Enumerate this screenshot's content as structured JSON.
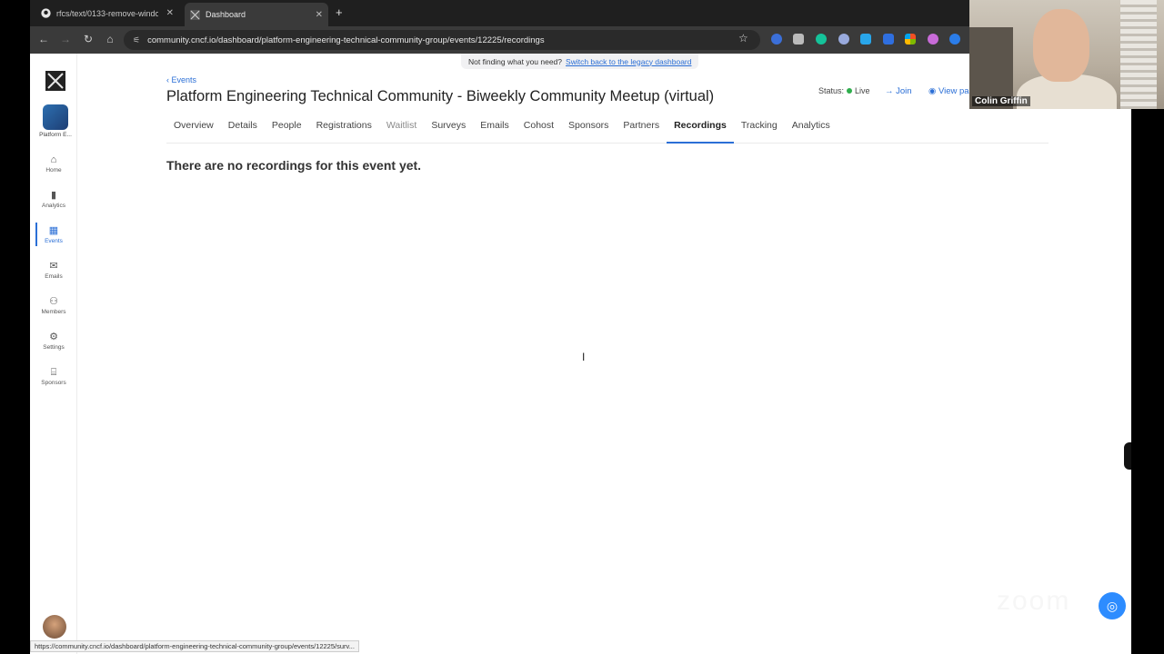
{
  "browser": {
    "tabs": [
      {
        "label": "rfcs/text/0133-remove-window",
        "icon": "github-icon"
      },
      {
        "label": "Dashboard",
        "icon": "dashboard-favicon"
      }
    ],
    "url": "community.cncf.io/dashboard/platform-engineering-technical-community-group/events/12225/recordings",
    "status_url": "https://community.cncf.io/dashboard/platform-engineering-technical-community-group/events/12225/surv..."
  },
  "banner": {
    "text": "Not finding what you need?",
    "link": "Switch back to the legacy dashboard"
  },
  "sidebar": {
    "group_label": "Platform E...",
    "items": [
      {
        "label": "Home",
        "icon": "home-icon",
        "glyph": "⌂"
      },
      {
        "label": "Analytics",
        "icon": "analytics-icon",
        "glyph": "▮"
      },
      {
        "label": "Events",
        "icon": "calendar-icon",
        "glyph": "▦"
      },
      {
        "label": "Emails",
        "icon": "mail-icon",
        "glyph": "✉"
      },
      {
        "label": "Members",
        "icon": "members-icon",
        "glyph": "⚇"
      },
      {
        "label": "Settings",
        "icon": "gear-icon",
        "glyph": "⚙"
      },
      {
        "label": "Sponsors",
        "icon": "storefront-icon",
        "glyph": "⌸"
      }
    ],
    "active": "Events"
  },
  "event": {
    "breadcrumb": "Events",
    "title": "Platform Engineering Technical Community - Biweekly Community Meetup (virtual)",
    "status_label": "Status:",
    "status_value": "Live",
    "join_label": "Join",
    "view_label": "View pa"
  },
  "tabs": [
    "Overview",
    "Details",
    "People",
    "Registrations",
    "Waitlist",
    "Surveys",
    "Emails",
    "Cohost",
    "Sponsors",
    "Partners",
    "Recordings",
    "Tracking",
    "Analytics"
  ],
  "active_tab": "Recordings",
  "empty_message": "There are no recordings for this event yet.",
  "video": {
    "participant": "Colin Griffin"
  },
  "colors": {
    "accent": "#2b6fd6",
    "live": "#2fae4d"
  }
}
